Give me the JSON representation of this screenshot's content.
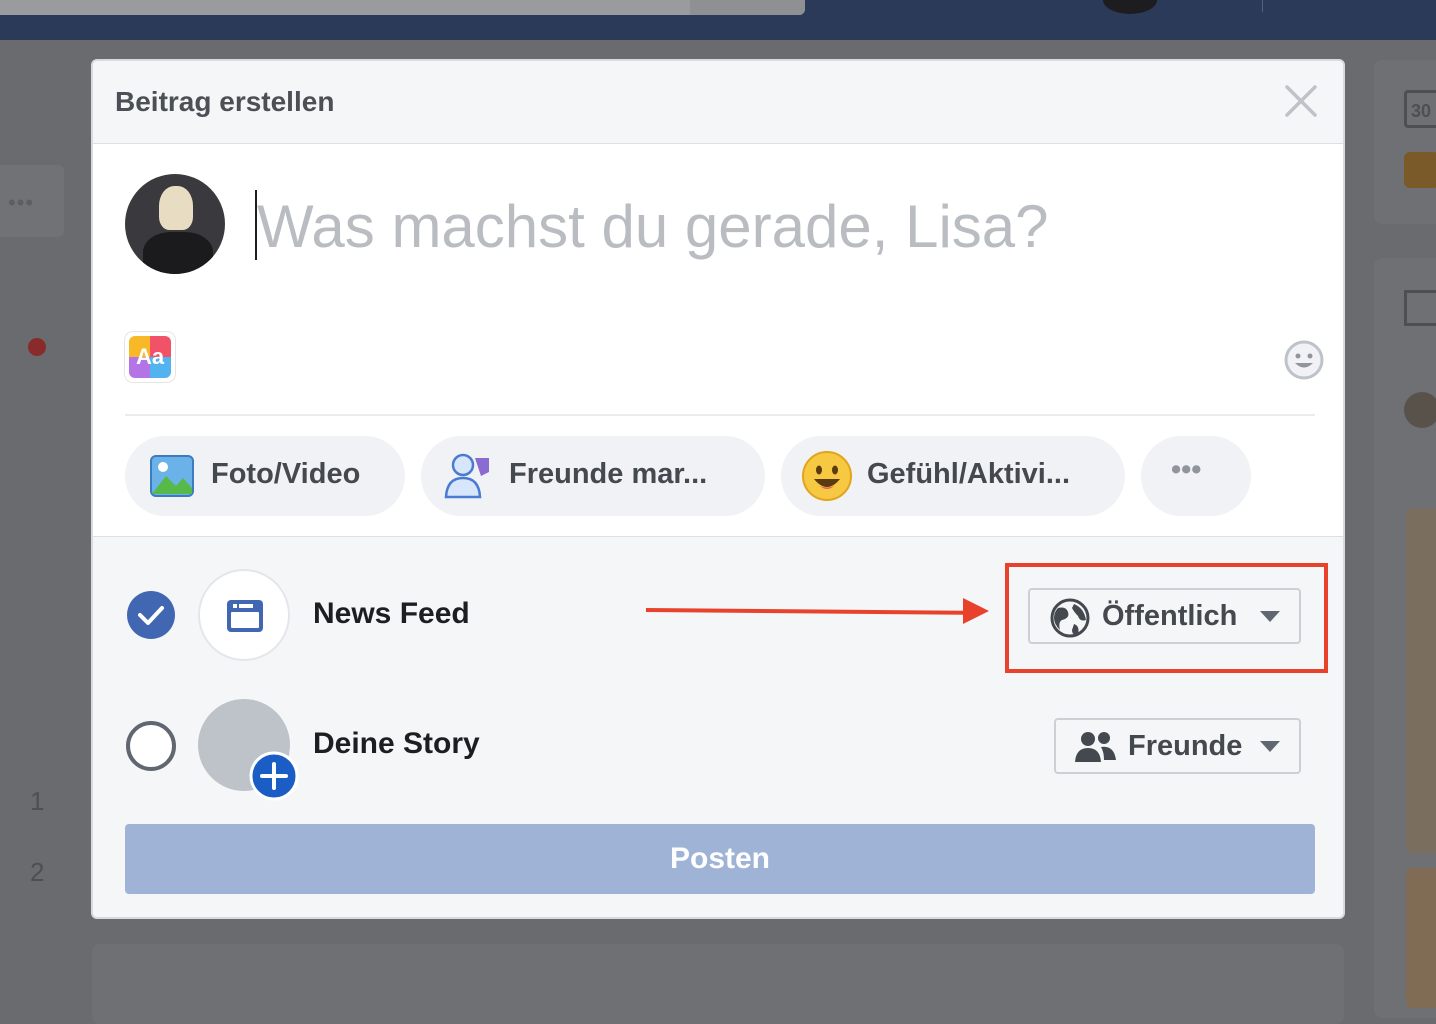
{
  "background": {
    "numbers": [
      "1",
      "2"
    ],
    "calendar_day": "30",
    "more_label": "•••"
  },
  "modal": {
    "title": "Beitrag erstellen",
    "composer": {
      "placeholder": "Was machst du gerade, Lisa?",
      "text_style_label": "Aa"
    },
    "actions": [
      {
        "label": "Foto/Video",
        "icon": "photo-icon"
      },
      {
        "label": "Freunde mar...",
        "icon": "tag-friends-icon"
      },
      {
        "label": "Gefühl/Aktivi...",
        "icon": "feeling-emoji-icon"
      },
      {
        "label": "•••",
        "icon": "more-icon"
      }
    ],
    "destinations": [
      {
        "label": "News Feed",
        "checked": true,
        "audience": "Öffentlich",
        "audience_icon": "globe-icon"
      },
      {
        "label": "Deine Story",
        "checked": false,
        "audience": "Freunde",
        "audience_icon": "friends-icon"
      }
    ],
    "post_label": "Posten"
  },
  "colors": {
    "accent": "#4267b2",
    "post_button": "#9fb3d6",
    "annotation": "#e8412c"
  }
}
